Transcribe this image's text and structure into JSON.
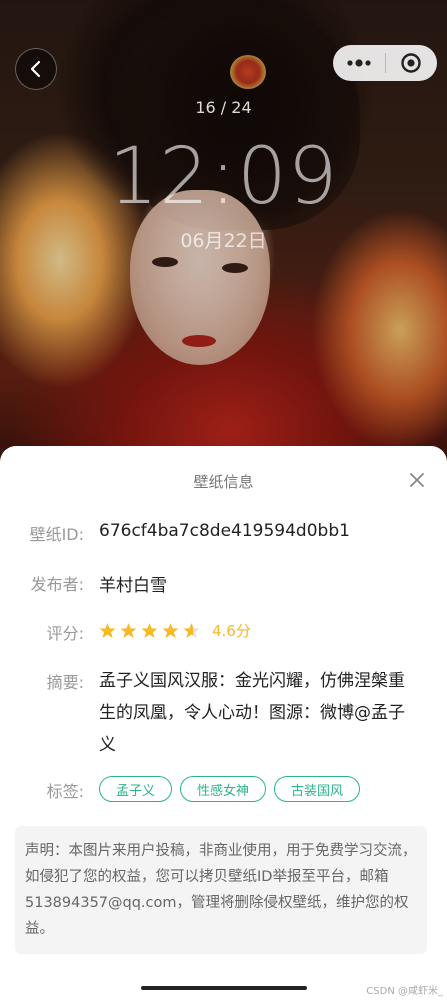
{
  "preview": {
    "counter": "16 / 24",
    "time": "12:09",
    "date": "06月22日"
  },
  "nav": {
    "back_icon": "chevron-left-icon",
    "capsule_menu_icon": "more-dots-icon",
    "capsule_close_icon": "target-circle-icon"
  },
  "sheet": {
    "title": "壁纸信息",
    "close_icon": "close-icon",
    "fields": {
      "id_label": "壁纸ID:",
      "id_value": "676cf4ba7c8de419594d0bb1",
      "publisher_label": "发布者:",
      "publisher_value": "羊村白雪",
      "rating_label": "评分:",
      "rating_value": 4.6,
      "rating_text": "4.6分",
      "summary_label": "摘要:",
      "summary_value": "孟子义国风汉服：金光闪耀，仿佛涅槃重生的凤凰，令人心动！图源：微博@孟子义",
      "tags_label": "标签:",
      "tags": [
        "孟子义",
        "性感女神",
        "古装国风"
      ]
    },
    "notice": "声明：本图片来用户投稿，非商业使用，用于免费学习交流，如侵犯了您的权益，您可以拷贝壁纸ID举报至平台，邮箱513894357@qq.com，管理将删除侵权壁纸，维护您的权益。"
  },
  "watermark": "CSDN @咸虾米_",
  "colors": {
    "accent": "#2bb58c",
    "star": "#f7b924",
    "star_empty": "#e0e0e0"
  }
}
